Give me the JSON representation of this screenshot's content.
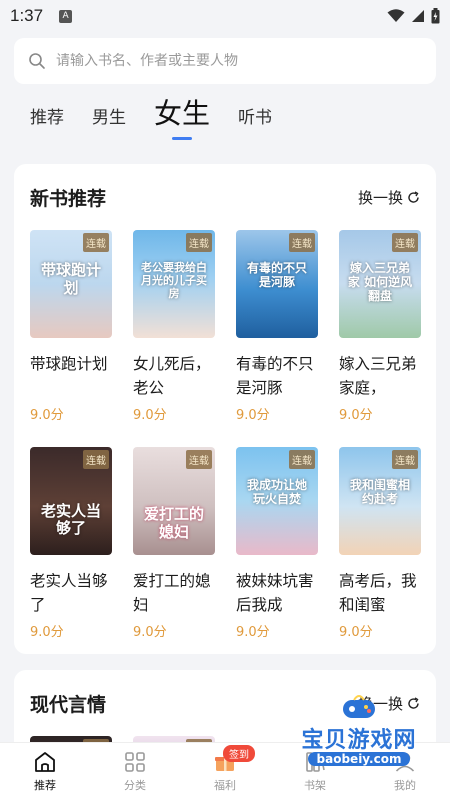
{
  "status": {
    "time": "1:37",
    "a_badge": "A"
  },
  "search": {
    "placeholder": "请输入书名、作者或主要人物"
  },
  "tabs": [
    {
      "label": "推荐"
    },
    {
      "label": "男生"
    },
    {
      "label": "女生"
    },
    {
      "label": "听书"
    }
  ],
  "sections": [
    {
      "title": "新书推荐",
      "refresh_label": "换一换",
      "books": [
        {
          "title": "带球跑计划",
          "score": "9.0分",
          "tag": "连载",
          "cover_text": "带球跑计划"
        },
        {
          "title": "女儿死后，老公",
          "score": "9.0分",
          "tag": "连载",
          "cover_text": "老公要我给白月光的儿子买房"
        },
        {
          "title": "有毒的不只是河豚",
          "score": "9.0分",
          "tag": "连载",
          "cover_text": "有毒的不只是河豚"
        },
        {
          "title": "嫁入三兄弟家庭，",
          "score": "9.0分",
          "tag": "连载",
          "cover_text": "嫁入三兄弟家 如何逆风翻盘"
        },
        {
          "title": "老实人当够了",
          "score": "9.0分",
          "tag": "连载",
          "cover_text": "老实人当够了"
        },
        {
          "title": "爱打工的媳妇",
          "score": "9.0分",
          "tag": "连载",
          "cover_text": "爱打工的媳妇"
        },
        {
          "title": "被妹妹坑害后我成",
          "score": "9.0分",
          "tag": "连载",
          "cover_text": "我成功让她玩火自焚"
        },
        {
          "title": "高考后，我和闺蜜",
          "score": "9.0分",
          "tag": "连载",
          "cover_text": "我和闺蜜相约赴考"
        }
      ]
    },
    {
      "title": "现代言情",
      "refresh_label": "换一换",
      "books": [
        {
          "tag": "连载"
        },
        {
          "tag": "连载"
        }
      ]
    }
  ],
  "bottom_nav": [
    {
      "label": "推荐",
      "icon": "home-icon"
    },
    {
      "label": "分类",
      "icon": "grid-icon"
    },
    {
      "label": "福利",
      "icon": "gift-icon",
      "badge": "签到"
    },
    {
      "label": "书架",
      "icon": "shelf-icon"
    },
    {
      "label": "我的",
      "icon": "user-icon"
    }
  ],
  "watermark": {
    "text": "宝贝游戏网",
    "url": "baobeiy.com"
  },
  "colors": {
    "accent": "#3f7df2",
    "score": "#e09a3c",
    "badge_red": "#f04a3a"
  }
}
